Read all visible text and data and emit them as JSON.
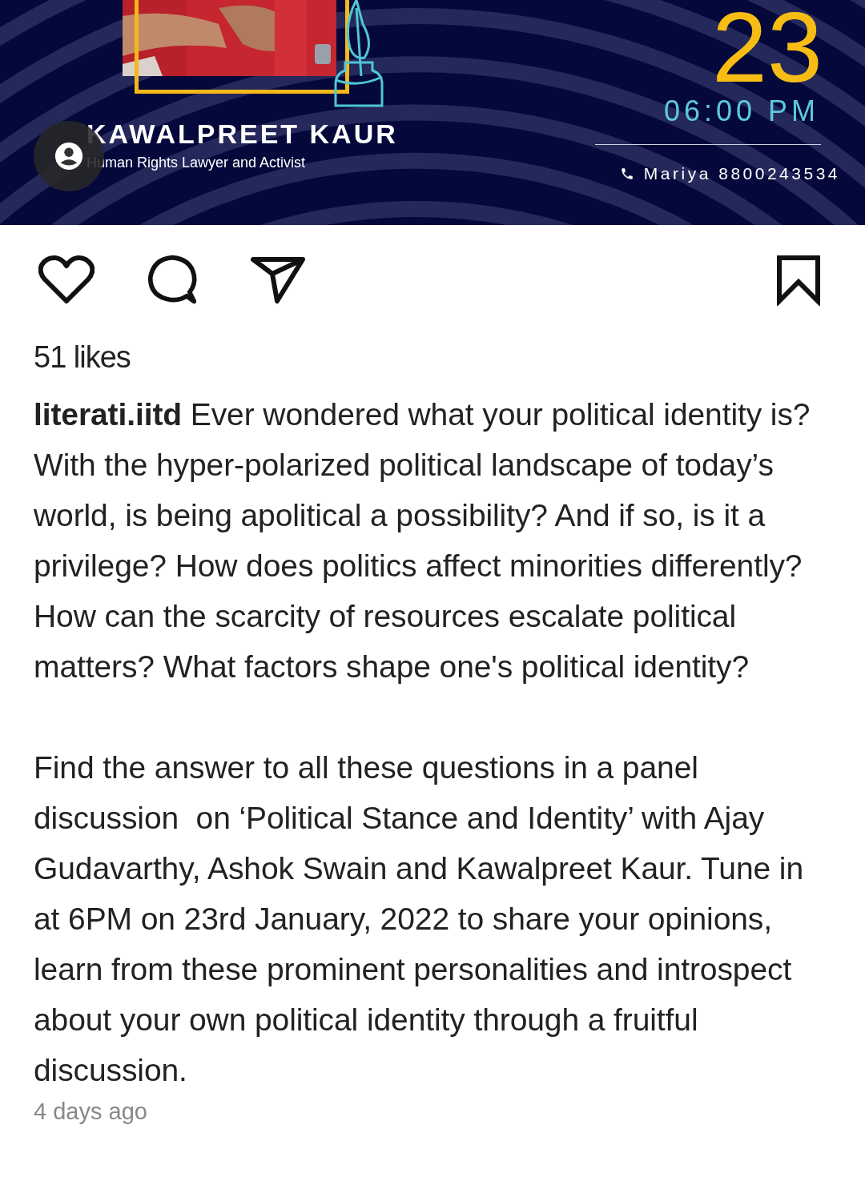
{
  "poster": {
    "speaker_name": "KAWALPREET KAUR",
    "speaker_role": "Human Rights Lawyer and Activist",
    "date": "23",
    "time": "06:00 PM",
    "contact": "Mariya 8800243534"
  },
  "actions": {
    "liked": false,
    "saved": false
  },
  "likes": "51 likes",
  "caption": [
    "**literati.iitd** Ever wondered what your political identity is? With the hyper-polarized political landscape of today’s world, is being apolitical a possibility? And if so, is it a privilege? How does politics affect minorities differently? How can the scarcity of resources escalate political matters? What factors shape one's political identity?",
    "Find the answer to all these questions in a panel discussion  on ‘Political Stance and Identity’ with Ajay Gudavarthy, Ashok Swain and Kawalpreet Kaur. Tune in at 6PM on 23rd January, 2022 to share your opinions, learn from these prominent personalities and introspect about your own political identity through a fruitful discussion."
  ],
  "timestamp": "4 days ago"
}
